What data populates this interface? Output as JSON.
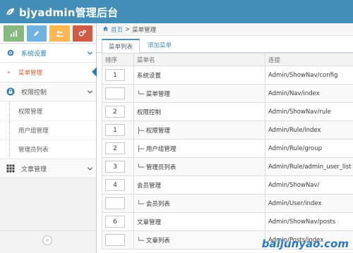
{
  "app": {
    "brand_title": "bjyadmin管理后台"
  },
  "colors": {
    "navbar": "#438eb9",
    "shortcut_green": "#87b87f",
    "shortcut_blue": "#6fb3e0",
    "shortcut_orange": "#ffb752",
    "shortcut_red": "#d15b47",
    "link": "#4c8fbd",
    "active_sub": "#c86139"
  },
  "shortcuts": [
    {
      "icon": "bar-chart-icon"
    },
    {
      "icon": "pencil-icon"
    },
    {
      "icon": "users-icon"
    },
    {
      "icon": "cogs-icon"
    }
  ],
  "sidebar": {
    "sections": [
      {
        "label": "系统设置",
        "icon": "gear-icon",
        "items": [
          {
            "label": "菜单管理",
            "active": true
          }
        ]
      },
      {
        "label": "权限控制",
        "icon": "lock-icon",
        "items": [
          {
            "label": "权限管理"
          },
          {
            "label": "用户组管理"
          },
          {
            "label": "管理员列表"
          }
        ]
      },
      {
        "label": "文章管理",
        "icon": "grid-icon",
        "items": []
      }
    ],
    "collapse_icon": "double-chevron-left-icon"
  },
  "breadcrumb": {
    "home": "首页",
    "separator": ">",
    "current": "菜单管理"
  },
  "tabs": [
    {
      "label": "菜单列表",
      "active": true
    },
    {
      "label": "添加菜单",
      "active": false
    }
  ],
  "table": {
    "headers": {
      "order": "排序",
      "name": "菜单名",
      "link": "连接"
    },
    "rows": [
      {
        "order": "1",
        "name": "系统设置",
        "link": "Admin/ShowNav/config"
      },
      {
        "order": "",
        "name": "└─ 菜单管理",
        "link": "Admin/Nav/index"
      },
      {
        "order": "2",
        "name": "权限控制",
        "link": "Admin/ShowNav/rule"
      },
      {
        "order": "1",
        "name": "├─ 权限管理",
        "link": "Admin/Rule/index"
      },
      {
        "order": "2",
        "name": "├─ 用户组管理",
        "link": "Admin/Rule/group"
      },
      {
        "order": "3",
        "name": "└─ 管理员列表",
        "link": "Admin/Rule/admin_user_list"
      },
      {
        "order": "4",
        "name": "会员管理",
        "link": "Admin/ShowNav/"
      },
      {
        "order": "",
        "name": "└─ 会员列表",
        "link": "Admin/User/index"
      },
      {
        "order": "6",
        "name": "文章管理",
        "link": "Admin/ShowNav/posts"
      },
      {
        "order": "",
        "name": "└─ 文章列表",
        "link": "Admin/Posts/index"
      }
    ]
  },
  "watermark": "baijunyao.com"
}
